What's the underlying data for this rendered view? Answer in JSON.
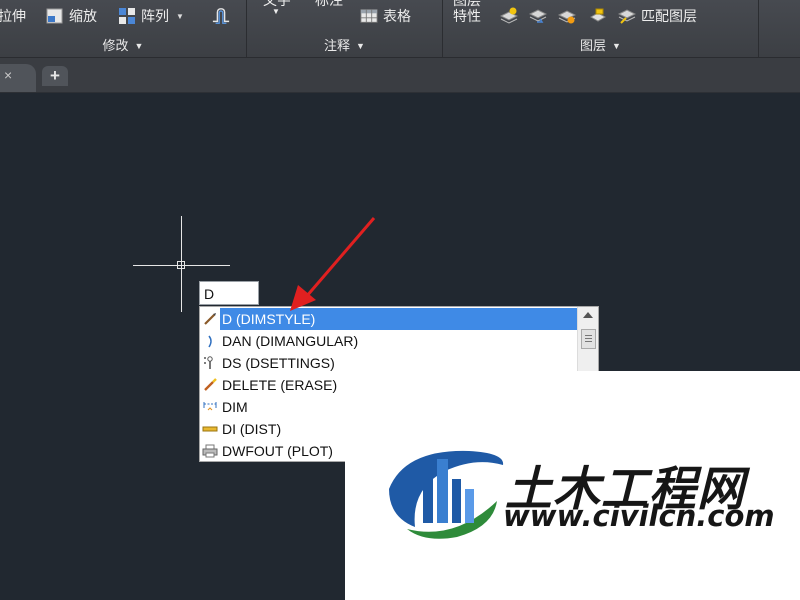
{
  "ribbon": {
    "modify": {
      "label": "修改",
      "stretch": "拉伸",
      "scale": "缩放",
      "array": "阵列"
    },
    "annotation": {
      "label": "注释",
      "text_partial": "文字",
      "dim_partial": "标注",
      "table": "表格"
    },
    "layers": {
      "label": "图层",
      "props_partial": "图层",
      "props": "特性",
      "match": "匹配图层"
    }
  },
  "tabs": {
    "close_glyph": "×",
    "new_glyph": "+"
  },
  "command": {
    "input_value": "D"
  },
  "suggestions": [
    {
      "label": "D (DIMSTYLE)",
      "icon": "dimstyle-icon",
      "selected": true
    },
    {
      "label": "DAN (DIMANGULAR)",
      "icon": "dimangular-icon",
      "selected": false
    },
    {
      "label": "DS (DSETTINGS)",
      "icon": "dsettings-icon",
      "selected": false
    },
    {
      "label": "DELETE (ERASE)",
      "icon": "erase-icon",
      "selected": false
    },
    {
      "label": "DIM",
      "icon": "dim-icon",
      "selected": false
    },
    {
      "label": "DI (DIST)",
      "icon": "measure-icon",
      "selected": false
    },
    {
      "label": "DWFOUT (PLOT)",
      "icon": "plot-icon",
      "selected": false
    }
  ],
  "watermark": {
    "title": "土木工程网",
    "url": "www.civilcn.com"
  },
  "colors": {
    "canvas": "#212830",
    "selection": "#3f8ae6",
    "arrow": "#e02020"
  }
}
